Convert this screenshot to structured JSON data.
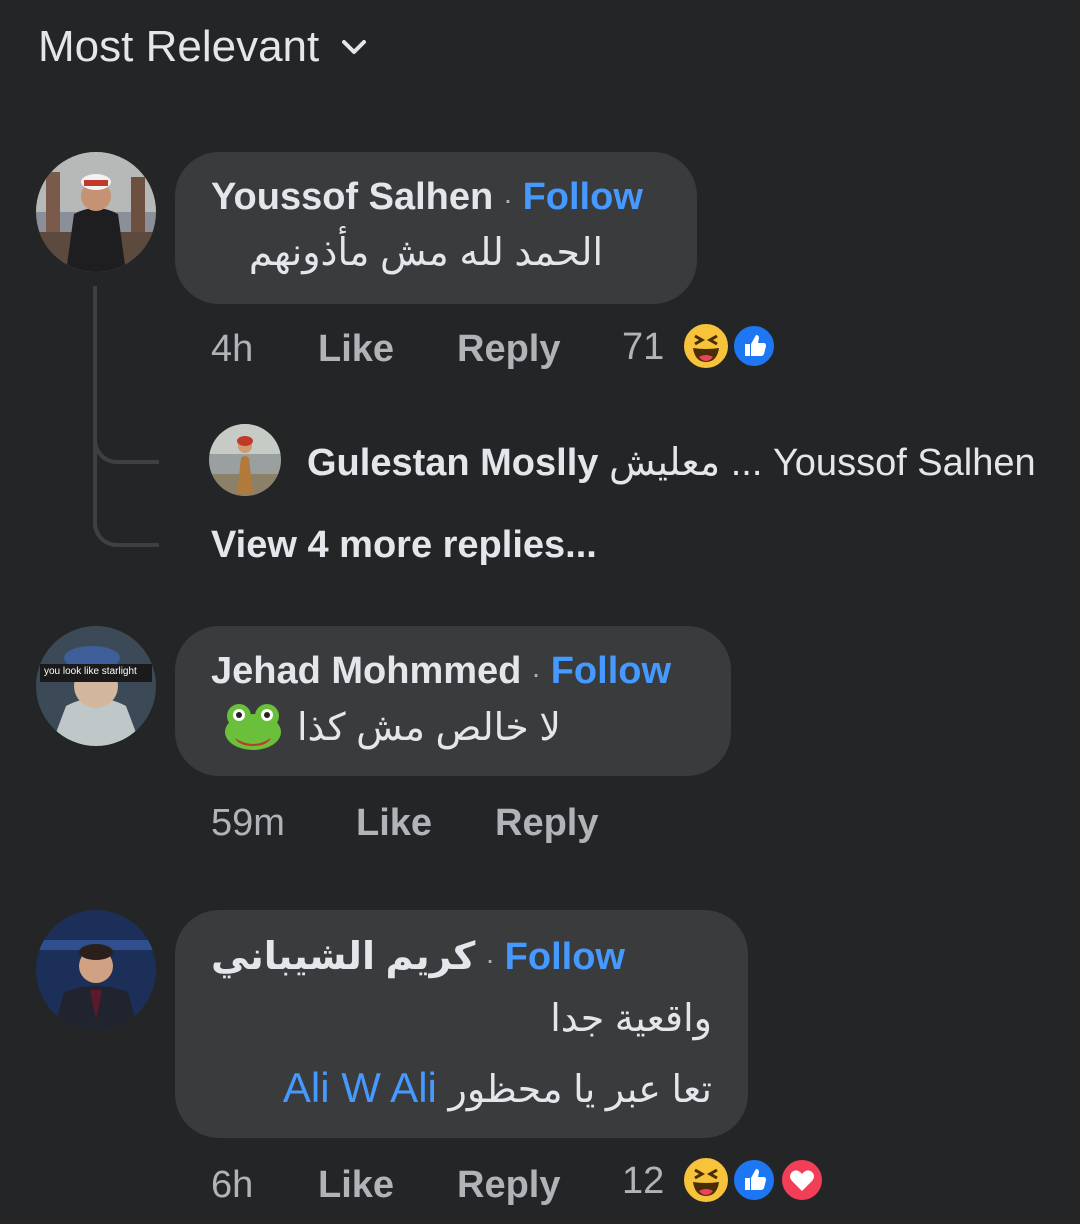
{
  "sort": {
    "label": "Most Relevant"
  },
  "comments": [
    {
      "author": "Youssof Salhen",
      "follow": "Follow",
      "text": "الحمد لله مش مأذونهم",
      "time": "4h",
      "like": "Like",
      "reply": "Reply",
      "reaction_count": "71",
      "reactions": [
        "haha",
        "like"
      ],
      "replies": {
        "preview_author": "Gulestan Moslly",
        "preview_text": "Youssof Salhen ... معليش",
        "more": "View 4 more replies..."
      }
    },
    {
      "author": "Jehad Mohmmed",
      "follow": "Follow",
      "text": "لا خالص مش كذا",
      "emoji": "frog-face",
      "avatar_caption": "you look like starlight",
      "time": "59m",
      "like": "Like",
      "reply": "Reply"
    },
    {
      "author": "كريم الشيباني",
      "follow": "Follow",
      "text_line1": "واقعية جدا",
      "text_line2": "تعا عبر يا محظور",
      "mention": "Ali W Ali",
      "time": "6h",
      "like": "Like",
      "reply": "Reply",
      "reaction_count": "12",
      "reactions": [
        "haha",
        "like",
        "love"
      ]
    }
  ],
  "colors": {
    "background": "#242526",
    "bubble": "#3a3b3c",
    "follow": "#4599ff",
    "meta": "#b0b3b8"
  }
}
